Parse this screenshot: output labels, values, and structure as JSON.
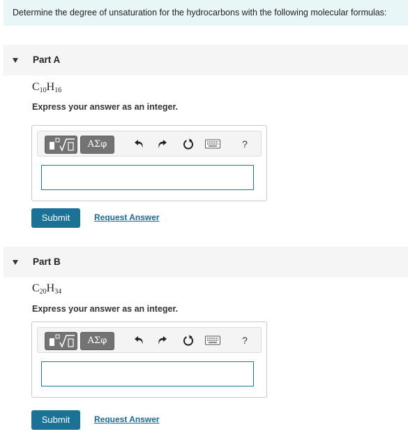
{
  "intro": {
    "text": "Determine the degree of unsaturation for the hydrocarbons with the following molecular formulas:"
  },
  "parts": [
    {
      "title": "Part A",
      "formula": {
        "c": "C",
        "c_sub": "10",
        "h": "H",
        "h_sub": "16"
      },
      "instruction": "Express your answer as an integer.",
      "greek_label": "ΑΣφ",
      "help_label": "?",
      "answer_value": "",
      "submit_label": "Submit",
      "request_label": "Request Answer"
    },
    {
      "title": "Part B",
      "formula": {
        "c": "C",
        "c_sub": "20",
        "h": "H",
        "h_sub": "34"
      },
      "instruction": "Express your answer as an integer.",
      "greek_label": "ΑΣφ",
      "help_label": "?",
      "answer_value": "",
      "submit_label": "Submit",
      "request_label": "Request Answer"
    }
  ],
  "icons": [
    "caret-down-icon",
    "templates-icon",
    "undo-icon",
    "redo-icon",
    "reset-icon",
    "keyboard-icon",
    "help-icon"
  ],
  "colors": {
    "accent": "#1a7396",
    "link": "#1a6b99",
    "intro_bg": "#e9f6f8",
    "tool_btn": "#737373"
  }
}
